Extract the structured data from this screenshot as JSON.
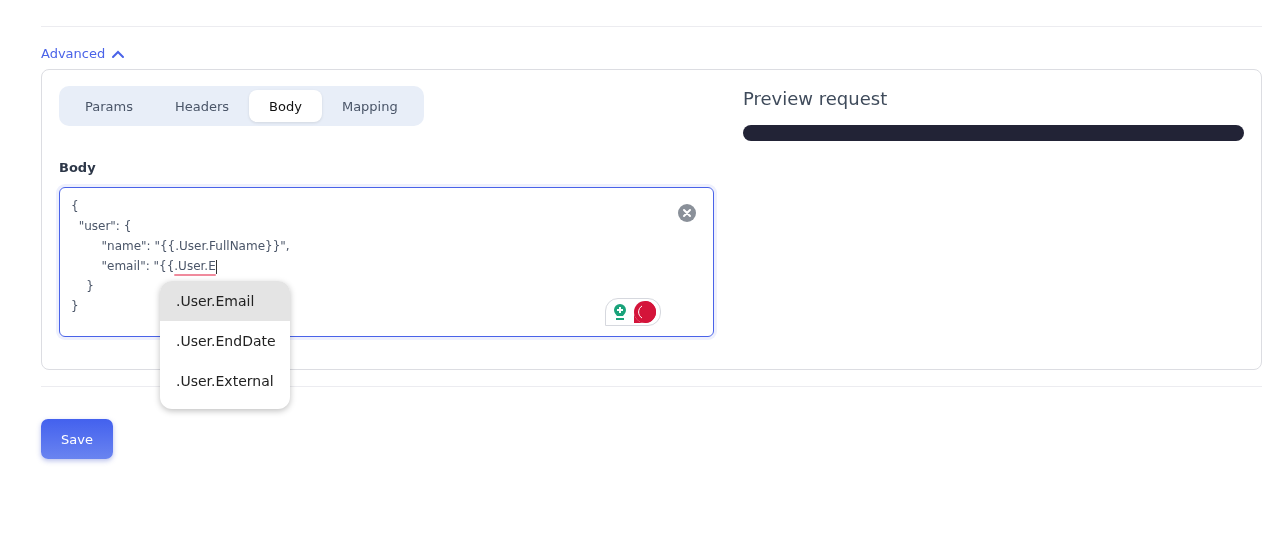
{
  "advanced": {
    "label": "Advanced",
    "expanded": true
  },
  "tabs": [
    {
      "label": "Params",
      "selected": false
    },
    {
      "label": "Headers",
      "selected": false
    },
    {
      "label": "Body",
      "selected": true
    },
    {
      "label": "Mapping",
      "selected": false
    }
  ],
  "body": {
    "label": "Body",
    "lines": [
      {
        "text": "{"
      },
      {
        "text": "  \"user\": {"
      },
      {
        "text": "        \"name\": \"{{.User.FullName}}\","
      },
      {
        "text": "        \"email\": \"{{",
        "misspelled": ".User.E"
      },
      {
        "text": "    }"
      },
      {
        "text": "}"
      }
    ]
  },
  "autocomplete": [
    {
      "label": ".User.Email",
      "selected": true
    },
    {
      "label": ".User.EndDate",
      "selected": false
    },
    {
      "label": ".User.External",
      "selected": false
    }
  ],
  "preview": {
    "title": "Preview request"
  },
  "save_button": "Save"
}
